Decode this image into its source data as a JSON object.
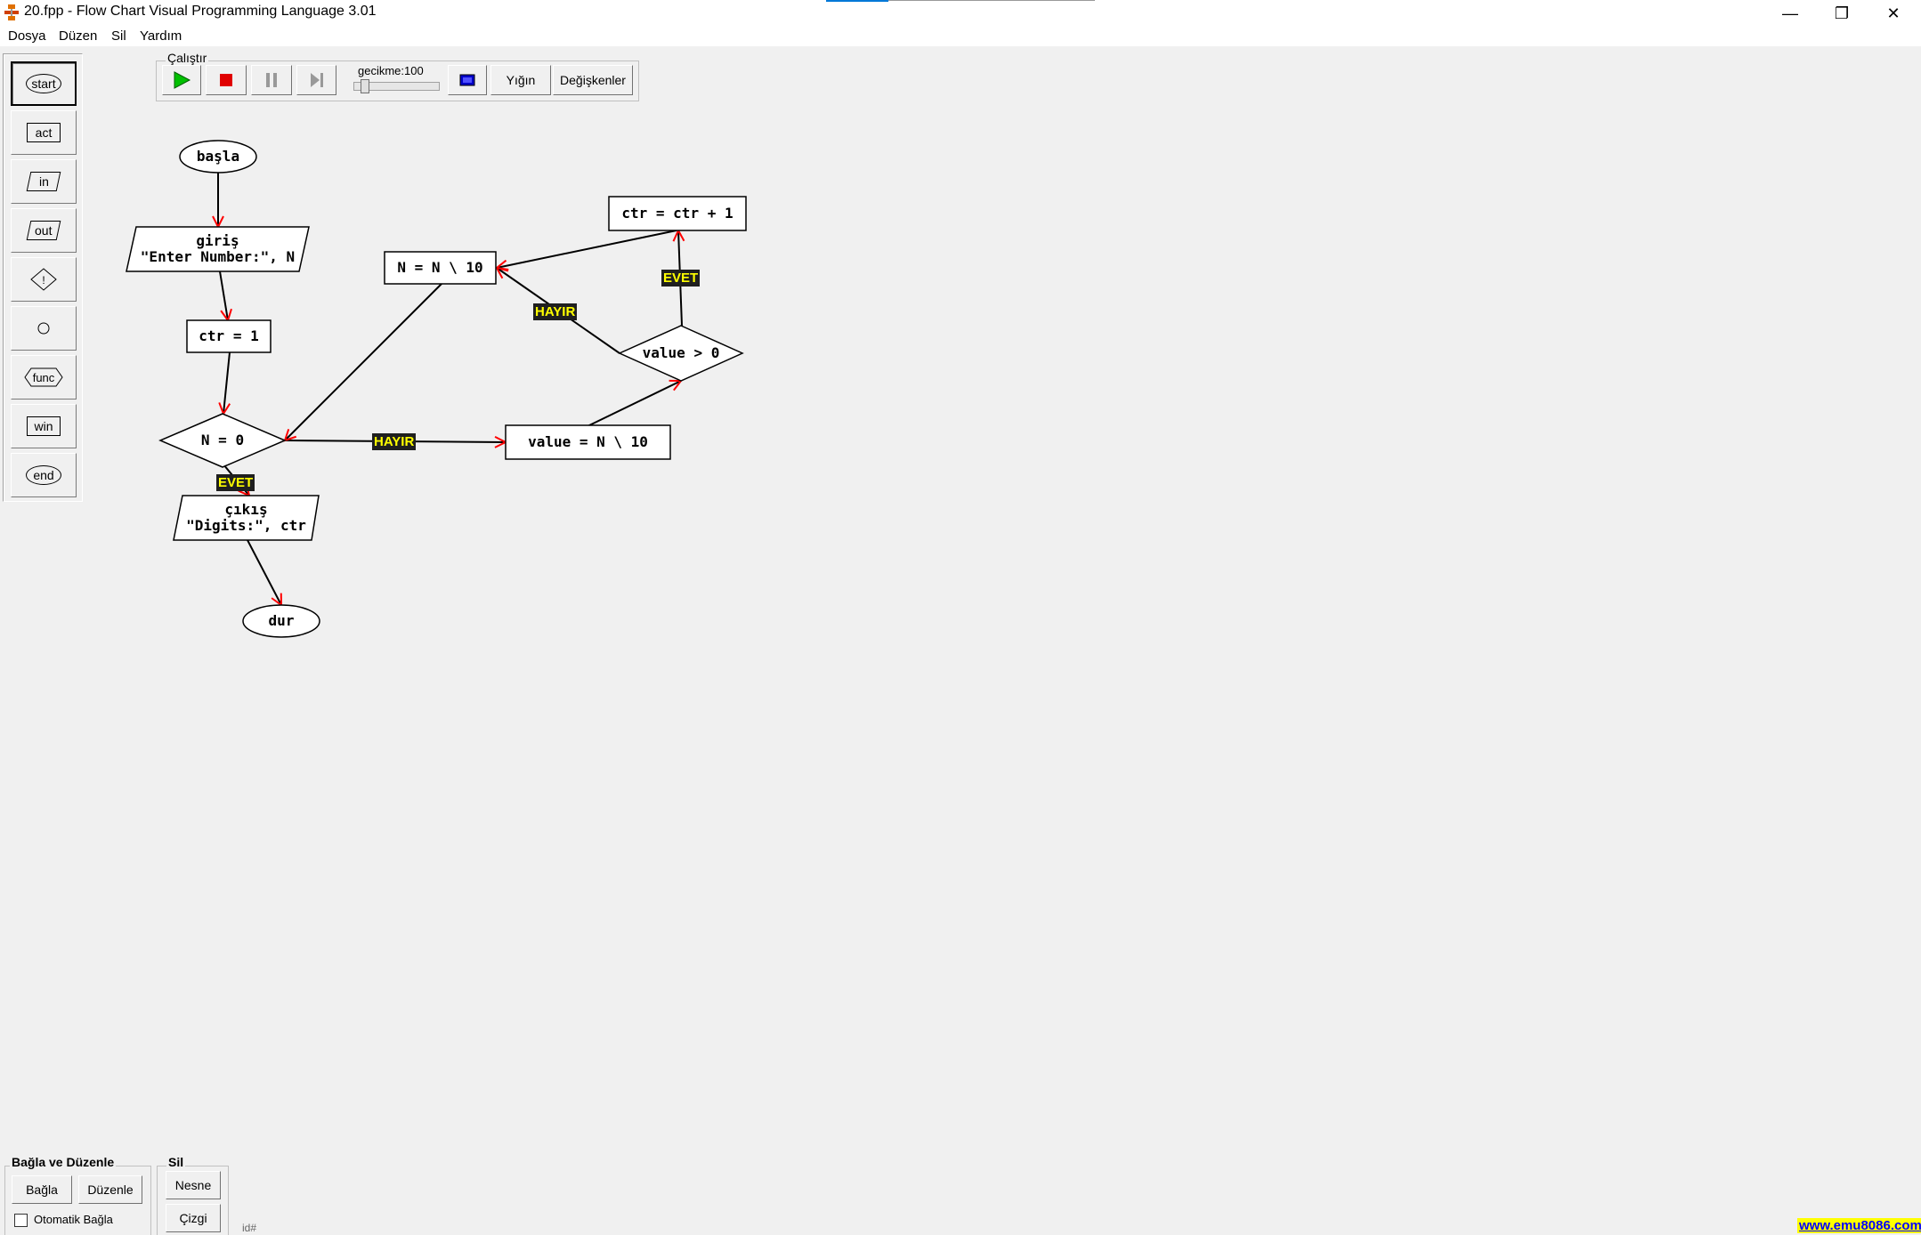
{
  "window": {
    "title": "20.fpp - Flow Chart Visual Programming Language 3.01",
    "controls": {
      "minimize": "—",
      "restore": "❐",
      "close": "✕"
    }
  },
  "menu": [
    "Dosya",
    "Düzen",
    "Sil",
    "Yardım"
  ],
  "palette": [
    "start",
    "act",
    "in",
    "out",
    "!",
    "",
    "func",
    "win",
    "end"
  ],
  "run": {
    "group_label": "Çalıştır",
    "delay_label": "gecikme:100",
    "stack_label": "Yığın",
    "variables_label": "Değişkenler"
  },
  "flow": {
    "start": "başla",
    "input": "giriş\n\"Enter Number:\", N",
    "init": "ctr = 1",
    "cond_n": "N = 0",
    "output": "çıkış\n\"Digits:\", ctr",
    "stop": "dur",
    "assign_value": "value = N \\ 10",
    "cond_value": "value > 0",
    "increment": "ctr = ctr + 1",
    "divide": "N = N \\ 10",
    "label_yes": "EVET",
    "label_no": "HAYIR"
  },
  "bottom": {
    "connect_group": "Bağla ve Düzenle",
    "connect_btn": "Bağla",
    "edit_btn": "Düzenle",
    "auto_connect": "Otomatik Bağla",
    "delete_group": "Sil",
    "object_btn": "Nesne",
    "line_btn": "Çizgi",
    "status_id": "id#",
    "link": "www.emu8086.com"
  },
  "colors": {
    "accent": "#0078d7",
    "arrow": "#ff0000",
    "label_bg": "#1f1f1f",
    "label_fg": "#ffff00"
  }
}
